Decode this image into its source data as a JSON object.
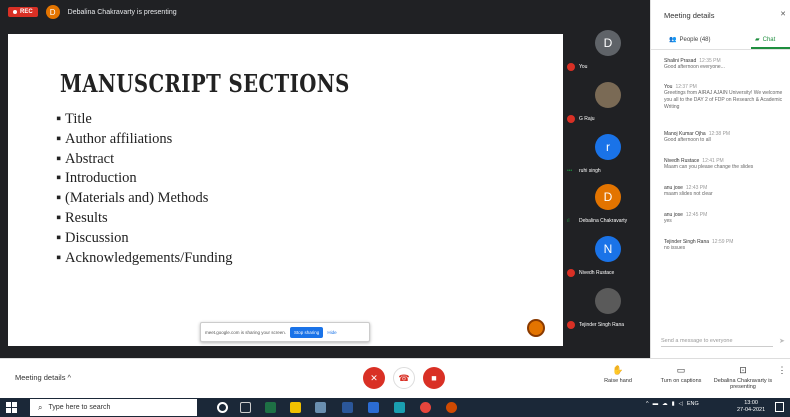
{
  "topbar": {
    "rec_label": "REC",
    "presenter_initial": "D",
    "presenter_text": "Debalina Chakravarty is presenting"
  },
  "slide": {
    "title": "MANUSCRIPT SECTIONS",
    "bullets": [
      "Title",
      "Author affiliations",
      "Abstract",
      "Introduction",
      "(Materials and) Methods",
      "Results",
      "Discussion",
      "Acknowledgements/Funding"
    ]
  },
  "share_bar": {
    "text": "meet.google.com is sharing your screen.",
    "stop_label": "Stop sharing",
    "hide_label": "Hide"
  },
  "participants": [
    {
      "initial": "D",
      "name": "You",
      "color": "#5f6368"
    },
    {
      "initial": "",
      "name": "G Raju",
      "color": "#7a6a55"
    },
    {
      "initial": "r",
      "name": "ruhi singh",
      "color": "#1a73e8"
    },
    {
      "initial": "D",
      "name": "Debalina Chakravarty",
      "color": "#e37400"
    },
    {
      "initial": "N",
      "name": "Nivedh Rustace",
      "color": "#1a73e8"
    },
    {
      "initial": "",
      "name": "Tejinder Singh Rana",
      "color": "#5a5a5a"
    }
  ],
  "side_panel": {
    "title": "Meeting details",
    "people_tab": "People (48)",
    "chat_tab": "Chat",
    "messages": [
      {
        "sender": "Shalini Prasad",
        "time": "12:35 PM",
        "text": "Good afternoon everyone..."
      },
      {
        "sender": "You",
        "time": "12:37 PM",
        "text": "Greetings from AIRAJ AJAIN University! We welcome you all to the DAY 2 of FDP on Research & Academic Writing"
      },
      {
        "sender": "Manoj Kumar Ojha",
        "time": "12:38 PM",
        "text": "Good afternoon to all"
      },
      {
        "sender": "Nivedh Rustace",
        "time": "12:41 PM",
        "text": "Maam can you please change the slides"
      },
      {
        "sender": "anu jose",
        "time": "12:43 PM",
        "text": "maam slides not clear"
      },
      {
        "sender": "anu jose",
        "time": "12:45 PM",
        "text": "yes"
      },
      {
        "sender": "Tejinder Singh Rana",
        "time": "12:59 PM",
        "text": "no issues"
      }
    ],
    "input_placeholder": "Send a message to everyone"
  },
  "bottombar": {
    "meeting_details": "Meeting details",
    "raise_hand": "Raise hand",
    "captions": "Turn on captions",
    "presenting": "Debalina Chakravarty is presenting"
  },
  "taskbar": {
    "search_placeholder": "Type here to search",
    "lang": "ENG",
    "time": "13:00",
    "date": "27-04-2021"
  }
}
